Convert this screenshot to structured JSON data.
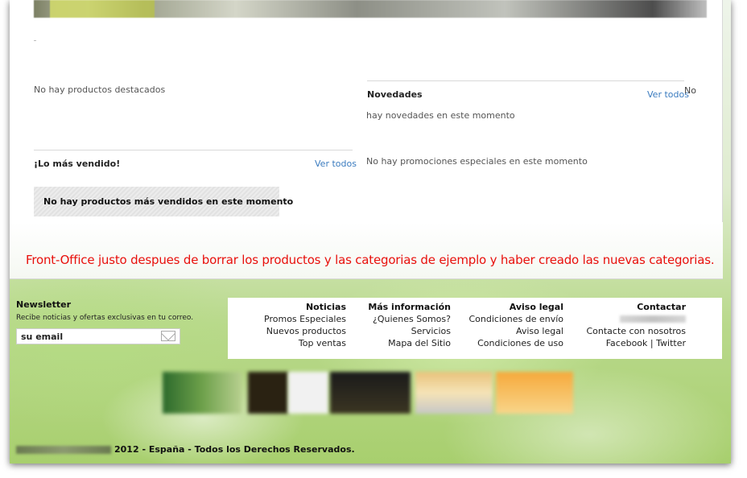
{
  "featured": {
    "empty_text": "No hay productos destacados"
  },
  "new_products": {
    "title": "Novedades",
    "view_all": "Ver todos",
    "empty_text": "hay novedades en este momento",
    "side_fragment": "No"
  },
  "best_sellers": {
    "title": "¡Lo más vendido!",
    "view_all": "Ver todos",
    "empty_text": "No hay productos más vendidos en este momento"
  },
  "specials": {
    "empty_text": "No hay promociones especiales en este momento"
  },
  "caption": "Front-Office justo despues de borrar los productos y las categorias de ejemplo y haber creado las nuevas categorias.",
  "newsletter": {
    "title": "Newsletter",
    "description": "Recibe noticias y ofertas exclusivas en tu correo.",
    "value": "su email",
    "icon": "envelope-icon"
  },
  "footer": {
    "noticias": {
      "title": "Noticias",
      "links": [
        "Promos Especiales",
        "Nuevos productos",
        "Top ventas"
      ]
    },
    "mas_info": {
      "title": "Más información",
      "links": [
        "¿Quienes Somos?",
        "Servicios",
        "Mapa del Sitio"
      ]
    },
    "aviso": {
      "title": "Aviso legal",
      "links": [
        "Condiciones de envío",
        "Aviso legal",
        "Condiciones de uso"
      ]
    },
    "contactar": {
      "title": "Contactar",
      "contact_link": "Contacte con nosotros",
      "facebook": "Facebook",
      "separator": "|",
      "twitter": "Twitter"
    }
  },
  "copyright": "2012 - España - Todos los Derechos Reservados.",
  "colors": {
    "caption": "#e8100c",
    "link": "#3a7bbf",
    "panel": "#ffffff"
  }
}
